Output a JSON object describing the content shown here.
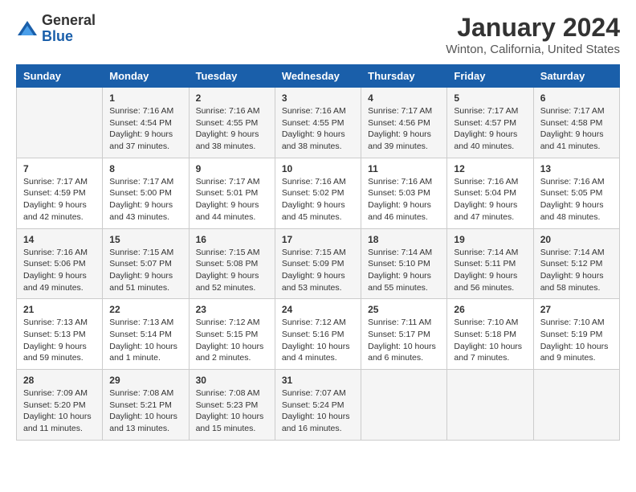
{
  "header": {
    "logo": {
      "general": "General",
      "blue": "Blue"
    },
    "title": "January 2024",
    "subtitle": "Winton, California, United States"
  },
  "columns": [
    "Sunday",
    "Monday",
    "Tuesday",
    "Wednesday",
    "Thursday",
    "Friday",
    "Saturday"
  ],
  "weeks": [
    [
      {
        "day": "",
        "info": ""
      },
      {
        "day": "1",
        "info": "Sunrise: 7:16 AM\nSunset: 4:54 PM\nDaylight: 9 hours\nand 37 minutes."
      },
      {
        "day": "2",
        "info": "Sunrise: 7:16 AM\nSunset: 4:55 PM\nDaylight: 9 hours\nand 38 minutes."
      },
      {
        "day": "3",
        "info": "Sunrise: 7:16 AM\nSunset: 4:55 PM\nDaylight: 9 hours\nand 38 minutes."
      },
      {
        "day": "4",
        "info": "Sunrise: 7:17 AM\nSunset: 4:56 PM\nDaylight: 9 hours\nand 39 minutes."
      },
      {
        "day": "5",
        "info": "Sunrise: 7:17 AM\nSunset: 4:57 PM\nDaylight: 9 hours\nand 40 minutes."
      },
      {
        "day": "6",
        "info": "Sunrise: 7:17 AM\nSunset: 4:58 PM\nDaylight: 9 hours\nand 41 minutes."
      }
    ],
    [
      {
        "day": "7",
        "info": "Sunrise: 7:17 AM\nSunset: 4:59 PM\nDaylight: 9 hours\nand 42 minutes."
      },
      {
        "day": "8",
        "info": "Sunrise: 7:17 AM\nSunset: 5:00 PM\nDaylight: 9 hours\nand 43 minutes."
      },
      {
        "day": "9",
        "info": "Sunrise: 7:17 AM\nSunset: 5:01 PM\nDaylight: 9 hours\nand 44 minutes."
      },
      {
        "day": "10",
        "info": "Sunrise: 7:16 AM\nSunset: 5:02 PM\nDaylight: 9 hours\nand 45 minutes."
      },
      {
        "day": "11",
        "info": "Sunrise: 7:16 AM\nSunset: 5:03 PM\nDaylight: 9 hours\nand 46 minutes."
      },
      {
        "day": "12",
        "info": "Sunrise: 7:16 AM\nSunset: 5:04 PM\nDaylight: 9 hours\nand 47 minutes."
      },
      {
        "day": "13",
        "info": "Sunrise: 7:16 AM\nSunset: 5:05 PM\nDaylight: 9 hours\nand 48 minutes."
      }
    ],
    [
      {
        "day": "14",
        "info": "Sunrise: 7:16 AM\nSunset: 5:06 PM\nDaylight: 9 hours\nand 49 minutes."
      },
      {
        "day": "15",
        "info": "Sunrise: 7:15 AM\nSunset: 5:07 PM\nDaylight: 9 hours\nand 51 minutes."
      },
      {
        "day": "16",
        "info": "Sunrise: 7:15 AM\nSunset: 5:08 PM\nDaylight: 9 hours\nand 52 minutes."
      },
      {
        "day": "17",
        "info": "Sunrise: 7:15 AM\nSunset: 5:09 PM\nDaylight: 9 hours\nand 53 minutes."
      },
      {
        "day": "18",
        "info": "Sunrise: 7:14 AM\nSunset: 5:10 PM\nDaylight: 9 hours\nand 55 minutes."
      },
      {
        "day": "19",
        "info": "Sunrise: 7:14 AM\nSunset: 5:11 PM\nDaylight: 9 hours\nand 56 minutes."
      },
      {
        "day": "20",
        "info": "Sunrise: 7:14 AM\nSunset: 5:12 PM\nDaylight: 9 hours\nand 58 minutes."
      }
    ],
    [
      {
        "day": "21",
        "info": "Sunrise: 7:13 AM\nSunset: 5:13 PM\nDaylight: 9 hours\nand 59 minutes."
      },
      {
        "day": "22",
        "info": "Sunrise: 7:13 AM\nSunset: 5:14 PM\nDaylight: 10 hours\nand 1 minute."
      },
      {
        "day": "23",
        "info": "Sunrise: 7:12 AM\nSunset: 5:15 PM\nDaylight: 10 hours\nand 2 minutes."
      },
      {
        "day": "24",
        "info": "Sunrise: 7:12 AM\nSunset: 5:16 PM\nDaylight: 10 hours\nand 4 minutes."
      },
      {
        "day": "25",
        "info": "Sunrise: 7:11 AM\nSunset: 5:17 PM\nDaylight: 10 hours\nand 6 minutes."
      },
      {
        "day": "26",
        "info": "Sunrise: 7:10 AM\nSunset: 5:18 PM\nDaylight: 10 hours\nand 7 minutes."
      },
      {
        "day": "27",
        "info": "Sunrise: 7:10 AM\nSunset: 5:19 PM\nDaylight: 10 hours\nand 9 minutes."
      }
    ],
    [
      {
        "day": "28",
        "info": "Sunrise: 7:09 AM\nSunset: 5:20 PM\nDaylight: 10 hours\nand 11 minutes."
      },
      {
        "day": "29",
        "info": "Sunrise: 7:08 AM\nSunset: 5:21 PM\nDaylight: 10 hours\nand 13 minutes."
      },
      {
        "day": "30",
        "info": "Sunrise: 7:08 AM\nSunset: 5:23 PM\nDaylight: 10 hours\nand 15 minutes."
      },
      {
        "day": "31",
        "info": "Sunrise: 7:07 AM\nSunset: 5:24 PM\nDaylight: 10 hours\nand 16 minutes."
      },
      {
        "day": "",
        "info": ""
      },
      {
        "day": "",
        "info": ""
      },
      {
        "day": "",
        "info": ""
      }
    ]
  ]
}
